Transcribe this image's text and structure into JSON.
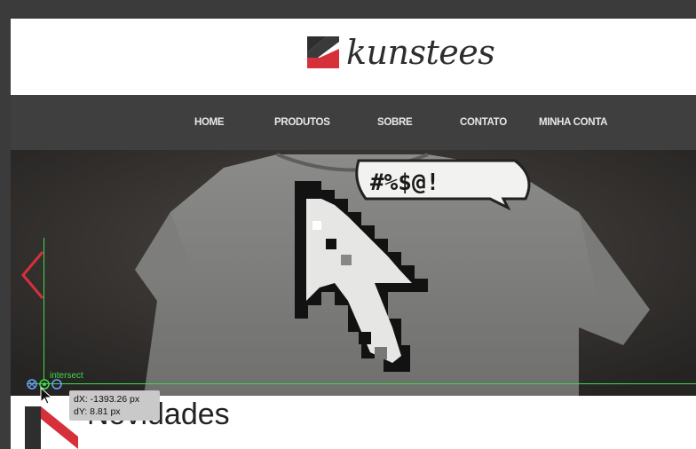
{
  "site": {
    "brand_name": "kunstees",
    "brand_colors": {
      "red": "#d6303a",
      "dark": "#2e2e2e"
    }
  },
  "nav": {
    "items": [
      {
        "label": "HOME"
      },
      {
        "label": "PRODUTOS"
      },
      {
        "label": "SOBRE"
      },
      {
        "label": "CONTATO"
      },
      {
        "label": "MINHA CONTA"
      }
    ]
  },
  "hero": {
    "image": "tshirt-with-pixel-cursor-and-speech-bubble",
    "speech_bubble_text": "#%$@!"
  },
  "section": {
    "title": "Novidades"
  },
  "measure_tool": {
    "intersect_label": "intersect",
    "dx": "dX: -1393.26 px",
    "dy": "dY: 8.81 px",
    "guide_color": "#3ddc4a"
  }
}
